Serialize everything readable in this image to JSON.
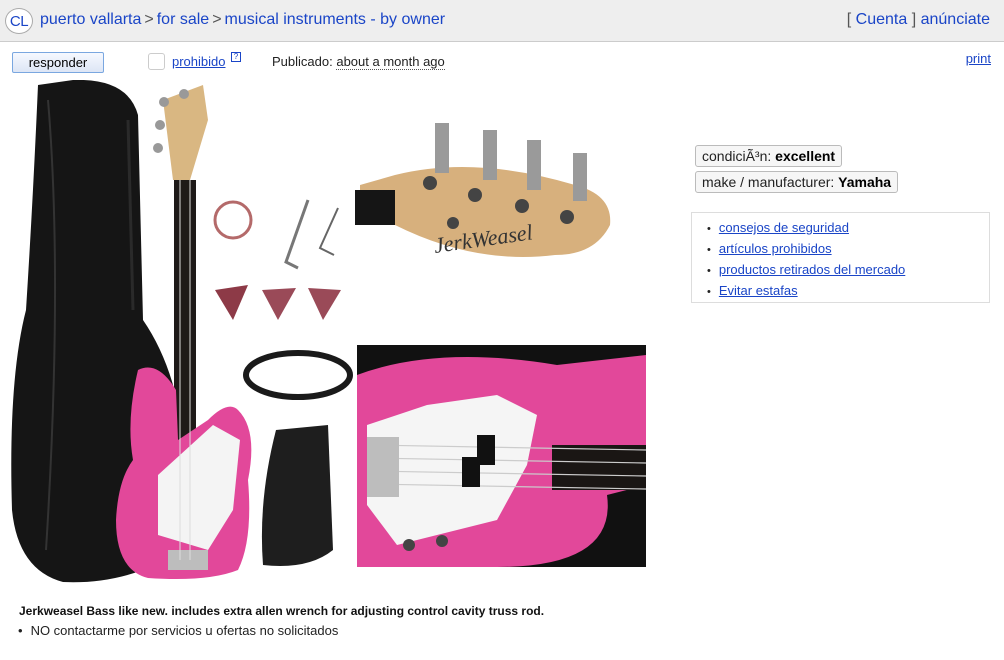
{
  "header": {
    "logo": "CL",
    "crumbs": [
      "puerto vallarta",
      "for sale",
      "musical instruments - by owner"
    ],
    "separator": ">",
    "account_open": "[",
    "account_label": "Cuenta",
    "account_close": "]",
    "post_label": "anúnciate"
  },
  "toolbar": {
    "reply_label": "responder",
    "flag_label": "prohibido",
    "flag_help": "?",
    "posted_label": "Publicado:",
    "posted_time": "about a month ago",
    "print_label": "print"
  },
  "attributes": [
    {
      "key": "condiciÃ³n:",
      "value": "excellent"
    },
    {
      "key": "make / manufacturer:",
      "value": "Yamaha"
    }
  ],
  "safety_links": [
    "consejos de seguridad",
    "artículos prohibidos",
    "productos retirados del mercado",
    "Evitar estafas"
  ],
  "posting": {
    "body": "Jerkweasel  Bass like new.  includes extra allen wrench for adjusting control cavity truss rod.",
    "notice": "NO contactarme por servicios u ofertas no solicitados"
  },
  "images": {
    "headstock_brand": "JerkWeasel",
    "body_color": "#e2489a"
  }
}
